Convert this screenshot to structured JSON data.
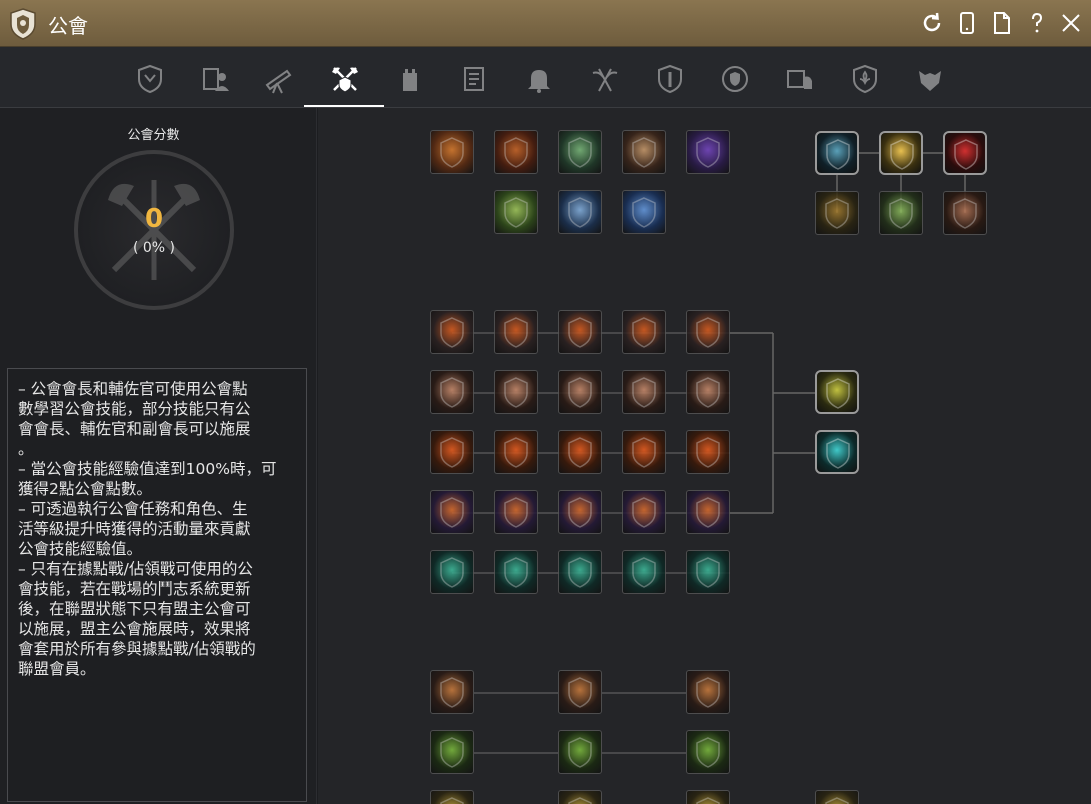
{
  "window": {
    "title": "公會",
    "icons": [
      "guild-shield-logo",
      "refresh-icon",
      "mobile-icon",
      "document-icon",
      "help-icon",
      "close-icon"
    ]
  },
  "tabs": [
    {
      "name": "guild-info",
      "icon": "shield-crest-icon"
    },
    {
      "name": "members",
      "icon": "scroll-person-icon"
    },
    {
      "name": "quests",
      "icon": "telescope-icon"
    },
    {
      "name": "skills",
      "icon": "crossed-axes-icon",
      "active": true
    },
    {
      "name": "castle",
      "icon": "tower-icon"
    },
    {
      "name": "records",
      "icon": "parchment-icon"
    },
    {
      "name": "alerts",
      "icon": "bell-icon"
    },
    {
      "name": "war",
      "icon": "winged-axes-icon"
    },
    {
      "name": "defense",
      "icon": "shield-pillar-icon"
    },
    {
      "name": "alliance",
      "icon": "laurel-shield-icon"
    },
    {
      "name": "mail",
      "icon": "letter-helmet-icon"
    },
    {
      "name": "emblem",
      "icon": "fleur-shield-icon"
    },
    {
      "name": "crest",
      "icon": "beast-mask-icon"
    }
  ],
  "score": {
    "label": "公會分數",
    "value": "0",
    "percent": "( 0% )"
  },
  "description": [
    "– 公會會長和輔佐官可使用公會點",
    "數學習公會技能，部分技能只有公",
    "會會長、輔佐官和副會長可以施展",
    "。",
    "– 當公會技能經驗值達到100%時，可",
    "獲得2點公會點數。",
    "– 可透過執行公會任務和角色、生",
    "活等級提升時獲得的活動量來貢獻",
    "公會技能經驗值。",
    "– 只有在據點戰/佔領戰可使用的公",
    "會技能，若在戰場的鬥志系統更新",
    "後，在聯盟狀態下只有盟主公會可",
    "以施展，盟主公會施展時，效果將",
    "會套用於所有參與據點戰/佔領戰的",
    "聯盟會員。"
  ],
  "colors": {
    "accent_gold": "#f0b640",
    "titlebar": "#7d6947",
    "panel": "#1f2023"
  },
  "skills": {
    "top_group": [
      "fire-shield-skill",
      "flame-armor-skill",
      "warrior-buff-skill",
      "crossed-swords-skill",
      "purple-crystal-skill",
      "claw-slash-skill",
      "blue-guardian-skill",
      "ice-gauntlet-skill"
    ],
    "top_right_group": [
      "dark-crown-skill",
      "gold-flower-skill",
      "red-wings-skill",
      "bronze-crown-skill",
      "clover-skill",
      "beast-head-skill"
    ],
    "mid_rows": [
      "shield-helm-skill",
      "sword-skill",
      "fire-skill",
      "spiral-hand-skill",
      "wind-claw-skill"
    ],
    "mid_targets": [
      "olive-helm-skill",
      "teal-helm-skill"
    ],
    "bottom_rows": [
      "lantern-skill",
      "green-leaf-skill",
      "gold-misc-skill"
    ]
  }
}
